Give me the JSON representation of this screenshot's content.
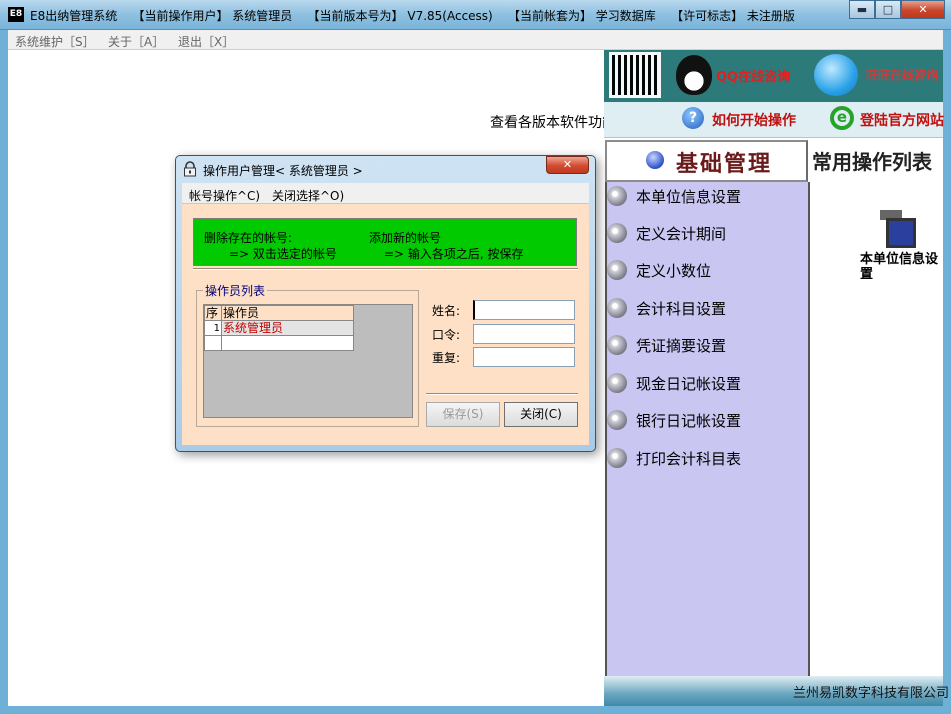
{
  "window": {
    "icon_text": "E8",
    "title": "E8出纳管理系统    【当前操作用户】 系统管理员    【当前版本号为】 V7.85(Access)    【当前帐套为】 学习数据库    【许可标志】 未注册版",
    "controls": {
      "minimize": "▬",
      "maximize": "□",
      "close": "✕"
    }
  },
  "menubar": [
    {
      "label": "系统维护［S］"
    },
    {
      "label": "关于［A］"
    },
    {
      "label": "退出［X］"
    }
  ],
  "main": {
    "help_link": "查看各版本软件功能区别"
  },
  "banner": {
    "qq_label": "QQ在线咨询",
    "bubble_label": "旺旺在线咨询",
    "howto_label": "如何开始操作",
    "login_label": "登陆官方网站"
  },
  "nav": {
    "header": "基础管理",
    "items": [
      {
        "label": "本单位信息设置"
      },
      {
        "label": "定义会计期间"
      },
      {
        "label": "定义小数位"
      },
      {
        "label": "会计科目设置"
      },
      {
        "label": "凭证摘要设置"
      },
      {
        "label": "现金日记帐设置"
      },
      {
        "label": "银行日记帐设置"
      },
      {
        "label": "打印会计科目表"
      }
    ]
  },
  "common_ops": {
    "title": "常用操作列表",
    "icon_label": "本单位信息设置"
  },
  "footer": {
    "company": "兰州易凯数字科技有限公司"
  },
  "dialog": {
    "title": "操作用户管理< 系统管理员 >",
    "close": "✕",
    "menu": [
      {
        "label": "帐号操作^C)"
      },
      {
        "label": "关闭选择^O)"
      }
    ],
    "info": {
      "delete_title": "删除存在的帐号:",
      "delete_hint": "=> 双击选定的帐号",
      "add_title": "添加新的帐号",
      "add_hint": "=> 输入各项之后, 按保存"
    },
    "group_title": "操作员列表",
    "table": {
      "headers": [
        "序",
        "操作员"
      ],
      "rows": [
        [
          "1",
          "系统管理员"
        ],
        [
          "",
          ""
        ]
      ]
    },
    "form": {
      "name_label": "姓名:",
      "name_value": "",
      "password_label": "口令:",
      "password_value": "",
      "repeat_label": "重复:",
      "repeat_value": ""
    },
    "buttons": {
      "save": "保存(S)",
      "close": "关闭(C)"
    }
  },
  "colors": {
    "info_green": "#01ca01",
    "dialog_body": "#fde0c6",
    "nav_bg": "#c9c6f1",
    "selected_text": "#c00000"
  }
}
